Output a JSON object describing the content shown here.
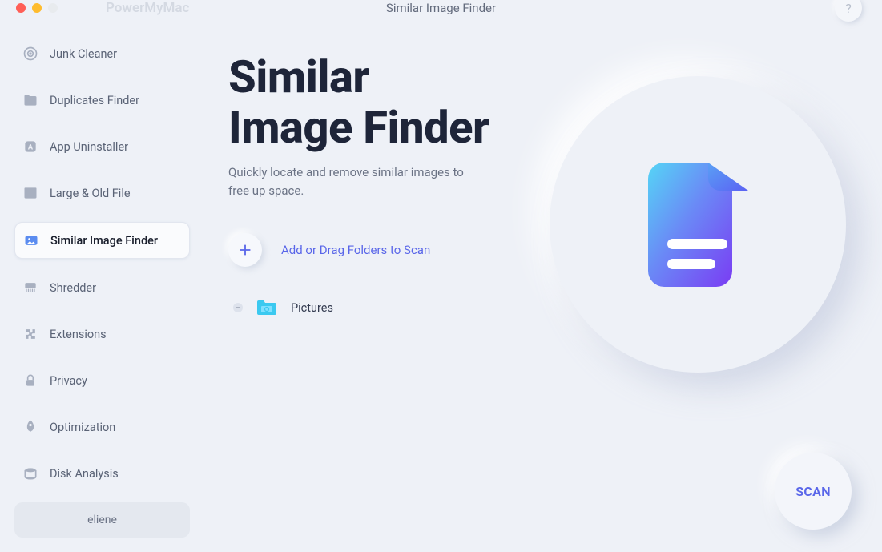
{
  "app": {
    "name": "PowerMyMac",
    "page_title": "Similar Image Finder"
  },
  "help_label": "?",
  "sidebar": {
    "items": [
      {
        "key": "junk-cleaner",
        "label": "Junk Cleaner",
        "active": false
      },
      {
        "key": "duplicates-finder",
        "label": "Duplicates Finder",
        "active": false
      },
      {
        "key": "app-uninstaller",
        "label": "App Uninstaller",
        "active": false
      },
      {
        "key": "large-old-file",
        "label": "Large & Old File",
        "active": false
      },
      {
        "key": "similar-image-finder",
        "label": "Similar Image Finder",
        "active": true
      },
      {
        "key": "shredder",
        "label": "Shredder",
        "active": false
      },
      {
        "key": "extensions",
        "label": "Extensions",
        "active": false
      },
      {
        "key": "privacy",
        "label": "Privacy",
        "active": false
      },
      {
        "key": "optimization",
        "label": "Optimization",
        "active": false
      },
      {
        "key": "disk-analysis",
        "label": "Disk Analysis",
        "active": false
      }
    ],
    "user": "eliene"
  },
  "content": {
    "heading_line1": "Similar",
    "heading_line2": "Image Finder",
    "description": "Quickly locate and remove similar images to free up space.",
    "add_label": "Add or Drag Folders to Scan",
    "folders": [
      {
        "name": "Pictures"
      }
    ]
  },
  "scan_label": "SCAN"
}
